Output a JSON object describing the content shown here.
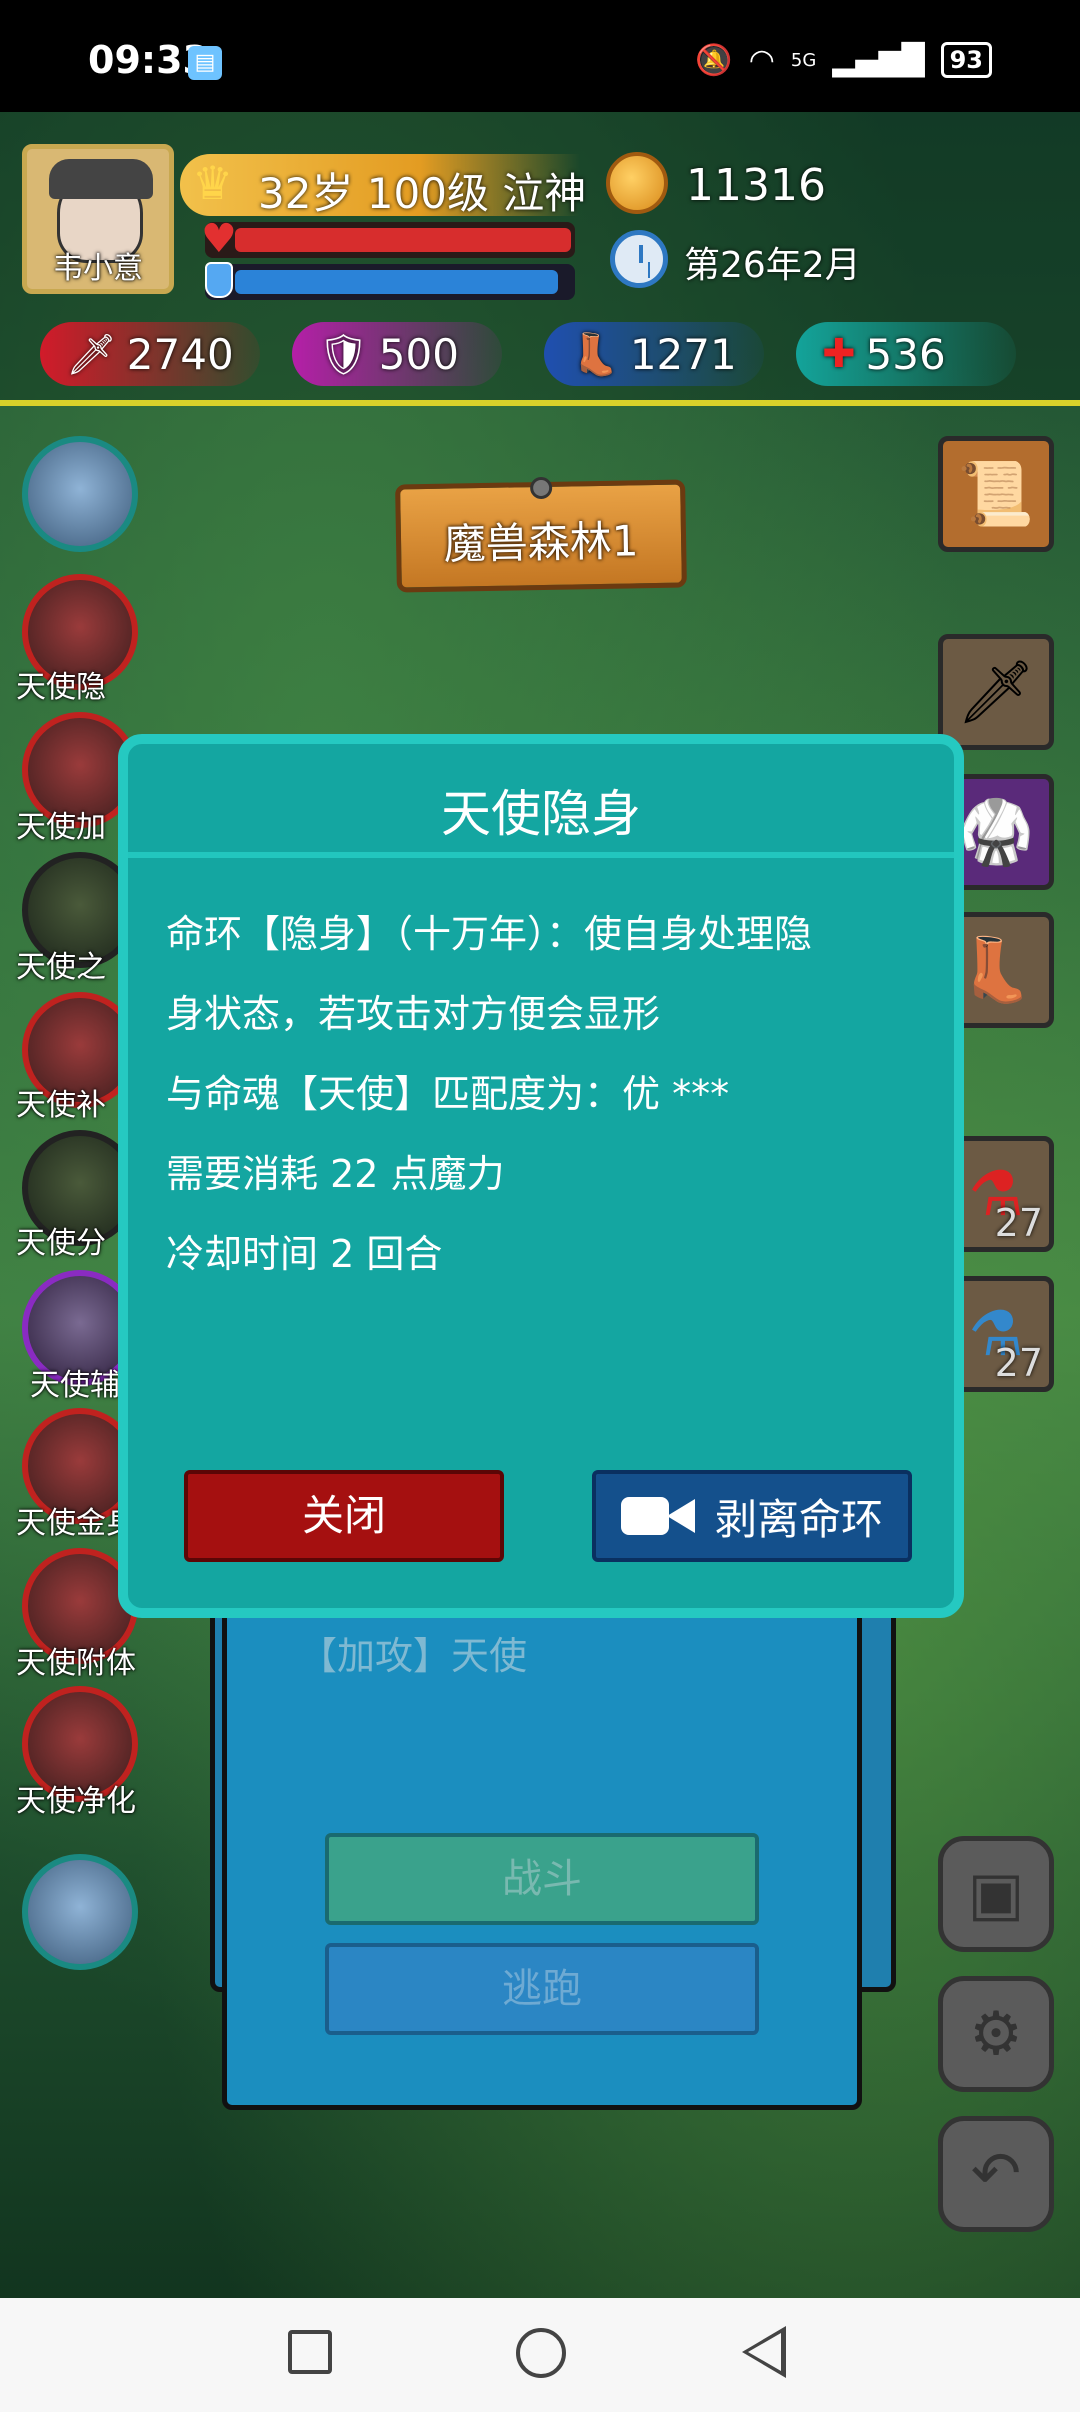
{
  "status_bar": {
    "time": "09:33",
    "app_icon": "book-icon",
    "network": "5G",
    "battery": "93"
  },
  "player": {
    "name": "韦小意",
    "level_text": "32岁 100级 泣神",
    "gold": "11316",
    "date": "第26年2月",
    "attack": "2740",
    "defense": "500",
    "speed": "1271",
    "health": "536",
    "hp_fraction": 1.0,
    "mp_fraction": 0.96
  },
  "location_sign": "魔兽森林1",
  "skills": [
    {
      "label": ""
    },
    {
      "label": "天使隐"
    },
    {
      "label": "天使加"
    },
    {
      "label": "天使之"
    },
    {
      "label": "天使补"
    },
    {
      "label": "天使分"
    },
    {
      "label": "天使辅"
    },
    {
      "label": "天使金身"
    },
    {
      "label": "天使附体"
    },
    {
      "label": "天使净化"
    },
    {
      "label": ""
    }
  ],
  "items": [
    {
      "icon": "map-scroll-icon",
      "count": ""
    },
    {
      "icon": "sword-icon",
      "count": ""
    },
    {
      "icon": "armor-icon",
      "count": ""
    },
    {
      "icon": "boots-icon",
      "count": ""
    },
    {
      "icon": "red-potion-icon",
      "count": "27"
    },
    {
      "icon": "blue-potion-icon",
      "count": "27"
    }
  ],
  "battle": {
    "enemy": "【加攻】天使",
    "fight": "战斗",
    "flee": "逃跑"
  },
  "modal": {
    "title": "天使隐身",
    "line1": "命环【隐身】（十万年）：使自身处理隐",
    "line2": "身状态，若攻击对方便会显形",
    "line3": "与命魂【天使】匹配度为：优 ***",
    "line4": "需要消耗 22 点魔力",
    "line5": "冷却时间 2 回合",
    "close_label": "关闭",
    "strip_label": "剥离命环"
  },
  "colors": {
    "modal_bg": "#14a6a1",
    "close_btn": "#a51010",
    "strip_btn": "#14508c",
    "hp": "#d72d2d",
    "mp": "#2b83d8"
  }
}
